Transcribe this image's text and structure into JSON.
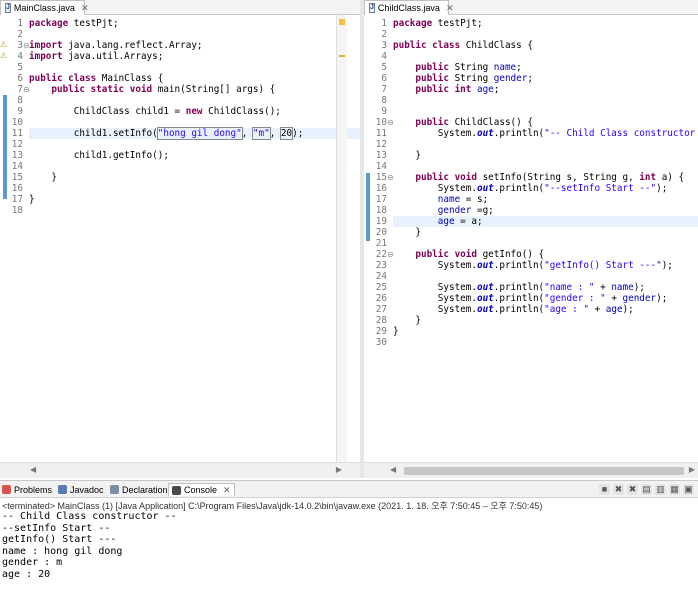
{
  "left_editor": {
    "tab_label": "MainClass.java",
    "lines": [
      [
        {
          "t": "package",
          "c": "kw"
        },
        {
          "t": " testPjt;"
        }
      ],
      [],
      [
        {
          "t": "import",
          "c": "kw"
        },
        {
          "t": " java.lang.reflect.Array;"
        }
      ],
      [
        {
          "t": "import",
          "c": "kw"
        },
        {
          "t": " java.util.Arrays;"
        }
      ],
      [],
      [
        {
          "t": "public class",
          "c": "kw"
        },
        {
          "t": " MainClass {"
        }
      ],
      [
        {
          "t": "    "
        },
        {
          "t": "public static void",
          "c": "kw"
        },
        {
          "t": " main(String[] args) {"
        }
      ],
      [],
      [
        {
          "t": "        ChildClass child1 = "
        },
        {
          "t": "new",
          "c": "kw"
        },
        {
          "t": " ChildClass();"
        }
      ],
      [],
      [
        {
          "t": "        child1.setInfo("
        },
        {
          "t": "\"hong gil dong\"",
          "c": "str bx"
        },
        {
          "t": ", "
        },
        {
          "t": "\"m\"",
          "c": "str bx"
        },
        {
          "t": ", "
        },
        {
          "t": "20",
          "c": "bx"
        },
        {
          "t": ");"
        }
      ],
      [],
      [
        {
          "t": "        child1.getInfo();"
        }
      ],
      [],
      [
        {
          "t": "    }"
        }
      ],
      [],
      [
        {
          "t": "}"
        }
      ],
      []
    ]
  },
  "right_editor": {
    "tab_label": "ChildClass.java",
    "lines": [
      [
        {
          "t": "package",
          "c": "kw"
        },
        {
          "t": " testPjt;"
        }
      ],
      [],
      [
        {
          "t": "public class",
          "c": "kw"
        },
        {
          "t": " ChildClass {"
        }
      ],
      [],
      [
        {
          "t": "    "
        },
        {
          "t": "public",
          "c": "kw"
        },
        {
          "t": " String "
        },
        {
          "t": "name",
          "c": "fld"
        },
        {
          "t": ";"
        }
      ],
      [
        {
          "t": "    "
        },
        {
          "t": "public",
          "c": "kw"
        },
        {
          "t": " String "
        },
        {
          "t": "gender",
          "c": "fld"
        },
        {
          "t": ";"
        }
      ],
      [
        {
          "t": "    "
        },
        {
          "t": "public int",
          "c": "kw"
        },
        {
          "t": " "
        },
        {
          "t": "age",
          "c": "fld"
        },
        {
          "t": ";"
        }
      ],
      [],
      [],
      [
        {
          "t": "    "
        },
        {
          "t": "public",
          "c": "kw"
        },
        {
          "t": " ChildClass() {"
        }
      ],
      [
        {
          "t": "        System."
        },
        {
          "t": "out",
          "c": "sfld"
        },
        {
          "t": ".println("
        },
        {
          "t": "\"-- Child Class constructor",
          "c": "str"
        }
      ],
      [],
      [
        {
          "t": "    }"
        }
      ],
      [],
      [
        {
          "t": "    "
        },
        {
          "t": "public void",
          "c": "kw"
        },
        {
          "t": " setInfo(String s, String g, "
        },
        {
          "t": "int",
          "c": "kw"
        },
        {
          "t": " a) {"
        }
      ],
      [
        {
          "t": "        System."
        },
        {
          "t": "out",
          "c": "sfld"
        },
        {
          "t": ".println("
        },
        {
          "t": "\"--setInfo Start --\"",
          "c": "str"
        },
        {
          "t": ");"
        }
      ],
      [
        {
          "t": "        "
        },
        {
          "t": "name",
          "c": "fld"
        },
        {
          "t": " = s;"
        }
      ],
      [
        {
          "t": "        "
        },
        {
          "t": "gender",
          "c": "fld"
        },
        {
          "t": " =g;"
        }
      ],
      [
        {
          "t": "        "
        },
        {
          "t": "age",
          "c": "fld"
        },
        {
          "t": " = a;"
        }
      ],
      [
        {
          "t": "    }"
        }
      ],
      [],
      [
        {
          "t": "    "
        },
        {
          "t": "public void",
          "c": "kw"
        },
        {
          "t": " getInfo() {"
        }
      ],
      [
        {
          "t": "        System."
        },
        {
          "t": "out",
          "c": "sfld"
        },
        {
          "t": ".println("
        },
        {
          "t": "\"getInfo() Start ---\"",
          "c": "str"
        },
        {
          "t": ");"
        }
      ],
      [],
      [
        {
          "t": "        System."
        },
        {
          "t": "out",
          "c": "sfld"
        },
        {
          "t": ".println("
        },
        {
          "t": "\"name : \"",
          "c": "str"
        },
        {
          "t": " + "
        },
        {
          "t": "name",
          "c": "fld"
        },
        {
          "t": ");"
        }
      ],
      [
        {
          "t": "        System."
        },
        {
          "t": "out",
          "c": "sfld"
        },
        {
          "t": ".println("
        },
        {
          "t": "\"gender : \"",
          "c": "str"
        },
        {
          "t": " + "
        },
        {
          "t": "gender",
          "c": "fld"
        },
        {
          "t": ");"
        }
      ],
      [
        {
          "t": "        System."
        },
        {
          "t": "out",
          "c": "sfld"
        },
        {
          "t": ".println("
        },
        {
          "t": "\"age : \"",
          "c": "str"
        },
        {
          "t": " + "
        },
        {
          "t": "age",
          "c": "fld"
        },
        {
          "t": ");"
        }
      ],
      [
        {
          "t": "    }"
        }
      ],
      [
        {
          "t": "}"
        }
      ],
      []
    ]
  },
  "console": {
    "tabs": [
      {
        "label": "Problems",
        "icon": "problems-icon",
        "color": "#d9534f"
      },
      {
        "label": "Javadoc",
        "icon": "javadoc-icon",
        "color": "#5b7bb5"
      },
      {
        "label": "Declaration",
        "icon": "declaration-icon",
        "color": "#7a8fa6"
      },
      {
        "label": "Console",
        "icon": "console-icon",
        "color": "#4a4a4a"
      }
    ],
    "terminated": "<terminated> MainClass (1) [Java Application] C:\\Program Files\\Java\\jdk-14.0.2\\bin\\javaw.exe  (2021. 1. 18. 오후 7:50:45 – 오후 7:50:45)",
    "output": [
      "-- Child Class constructor --",
      "--setInfo Start --",
      "getInfo() Start ---",
      "name : hong gil dong",
      "gender : m",
      "age : 20"
    ]
  }
}
